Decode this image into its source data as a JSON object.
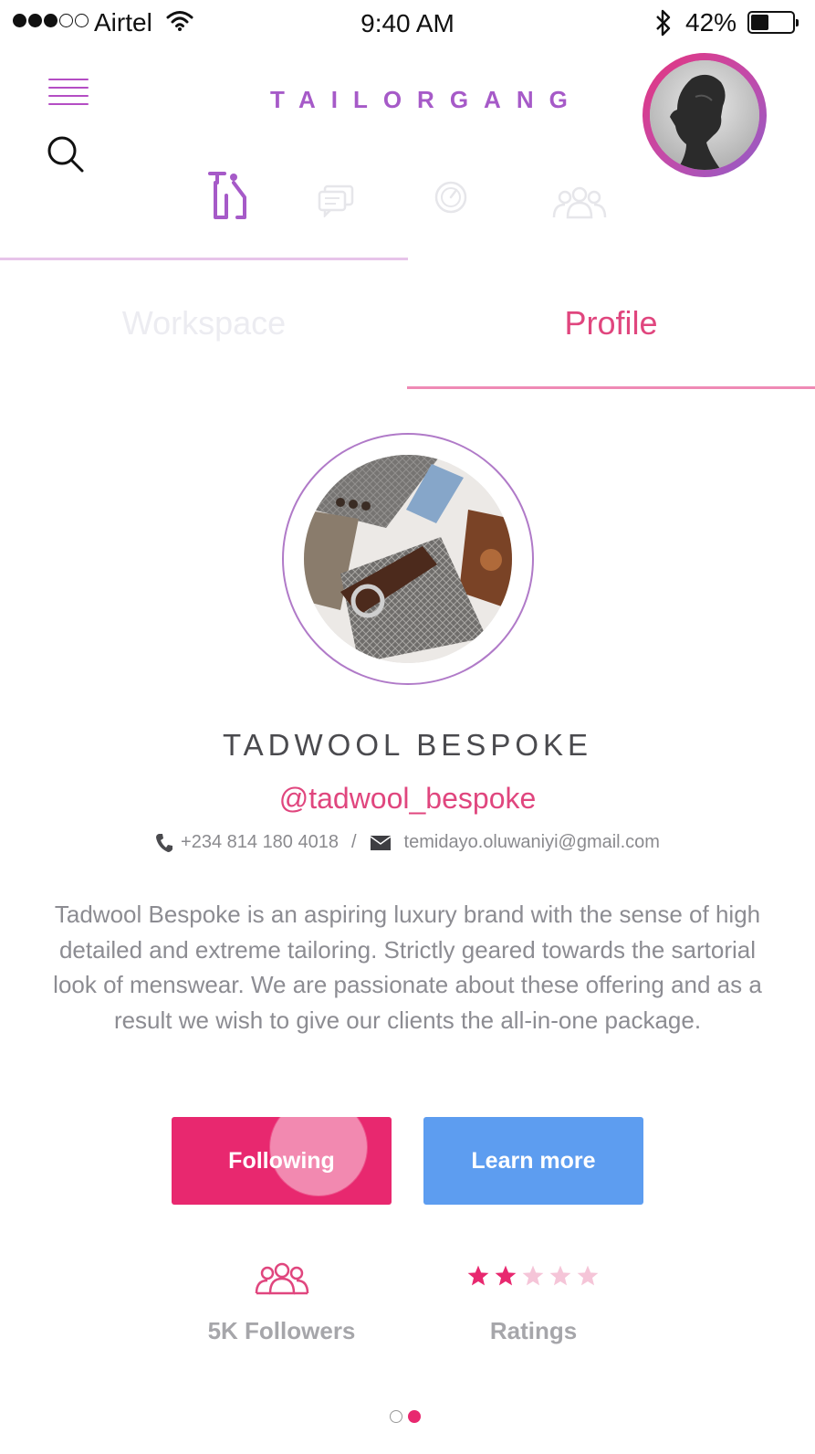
{
  "status_bar": {
    "carrier": "Airtel",
    "time": "9:40 AM",
    "battery": "42%",
    "signal_bars": 3,
    "signal_total": 5,
    "battery_level": 0.42
  },
  "header": {
    "brand": "TAILORGANG"
  },
  "tabs": {
    "workspace": "Workspace",
    "profile": "Profile",
    "active": "profile"
  },
  "profile": {
    "name": "TADWOOL BESPOKE",
    "handle": "@tadwool_bespoke",
    "phone": "+234 814 180 4018",
    "separator": "/",
    "email": "temidayo.oluwaniyi@gmail.com",
    "bio": "Tadwool Bespoke is an aspiring luxury brand with the sense of high detailed and extreme tailoring. Strictly geared towards the sartorial look of menswear. We are passionate about these offering and as a result we wish to give our clients the all-in-one package."
  },
  "actions": {
    "following": "Following",
    "learn_more": "Learn more"
  },
  "stats": {
    "followers": "5K Followers",
    "ratings": "Ratings",
    "rating_value": 2,
    "rating_max": 5
  },
  "pager": {
    "pages": 2,
    "current": 2
  },
  "colors": {
    "brand_purple": "#a65ac8",
    "accent_pink": "#e8286f",
    "learn_blue": "#5d9df0"
  }
}
